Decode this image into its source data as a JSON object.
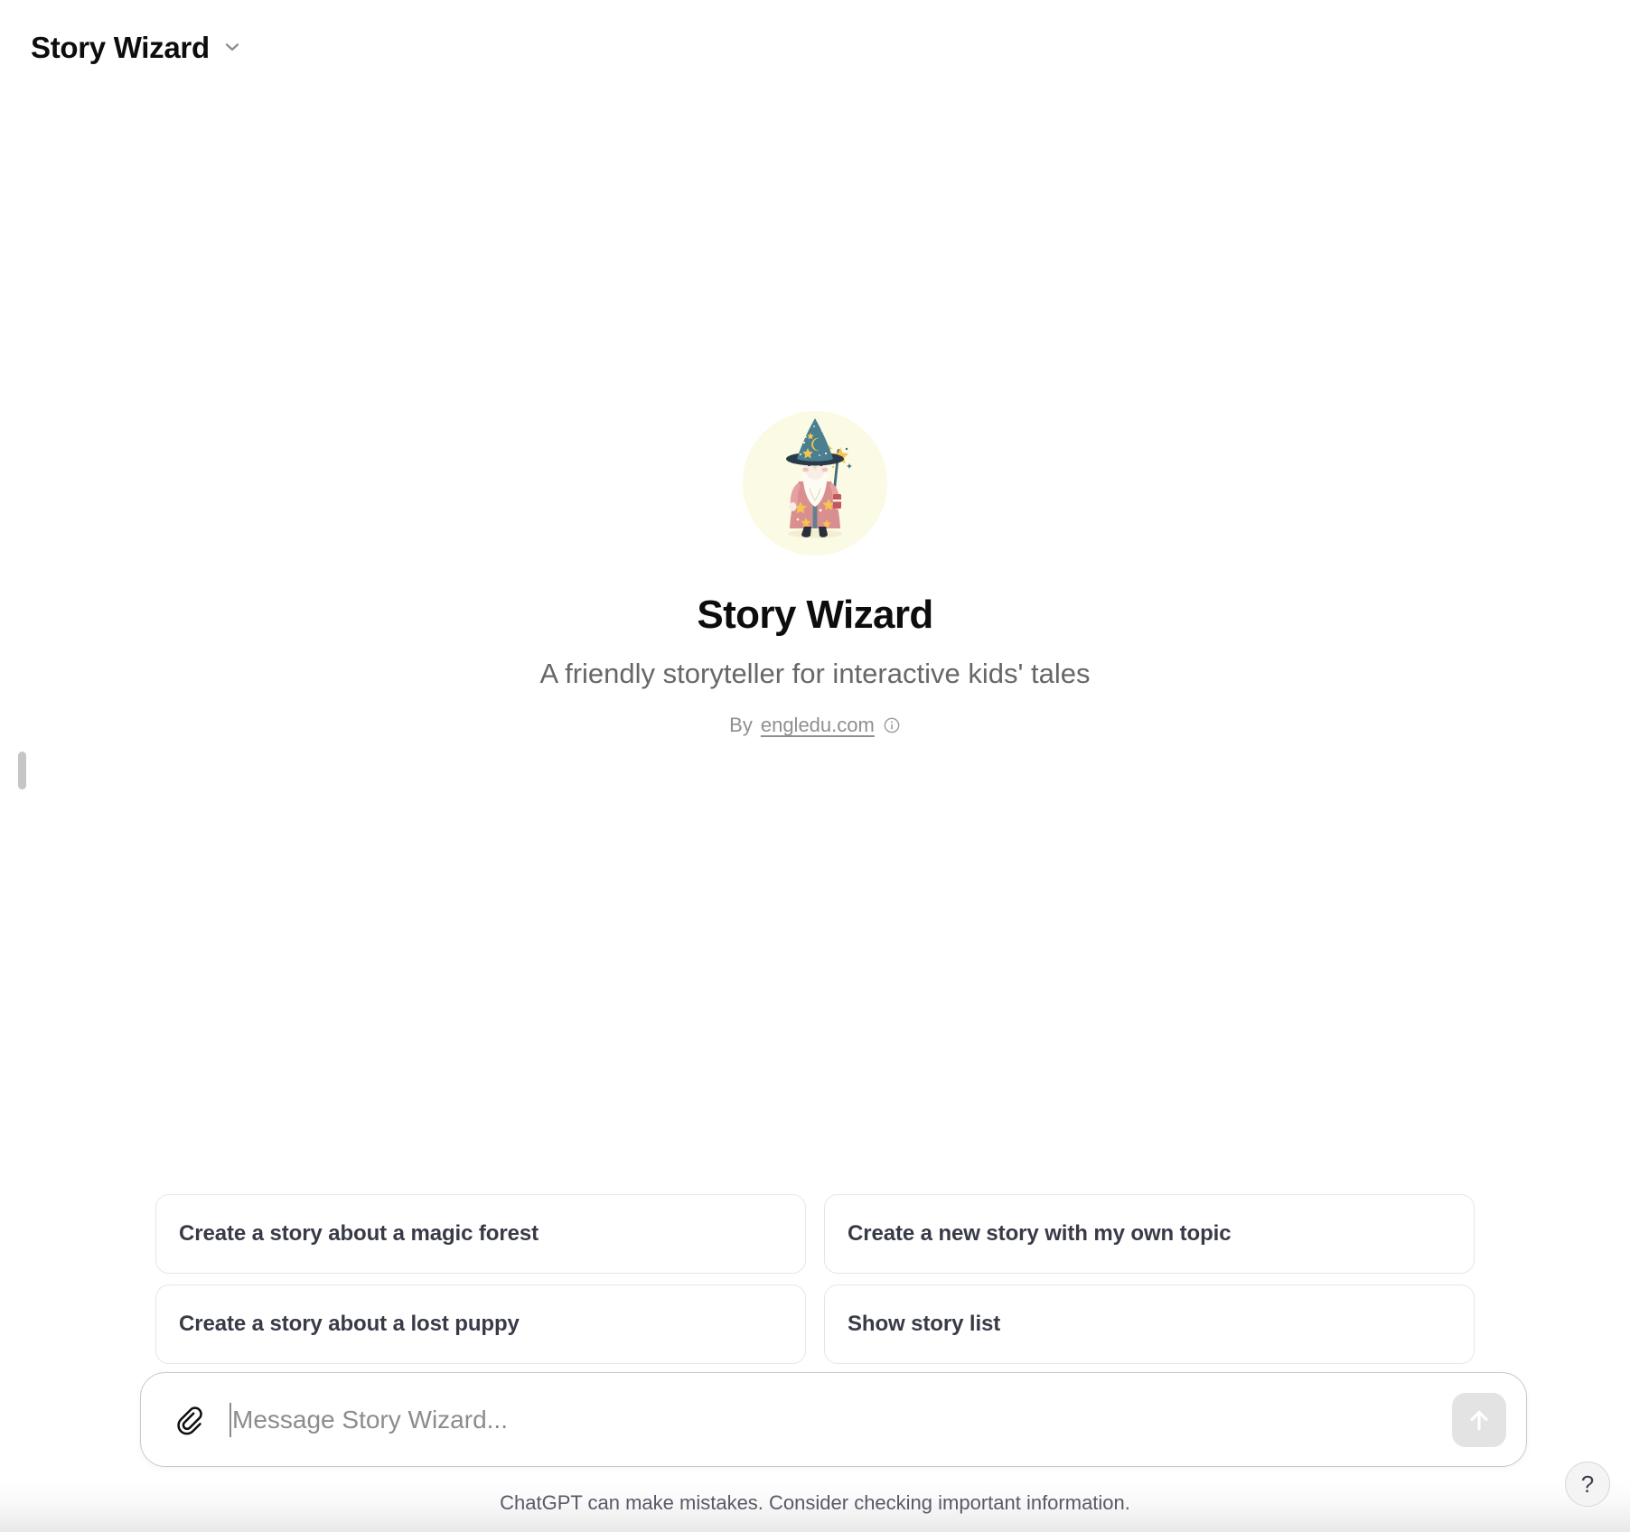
{
  "topbar": {
    "title": "Story Wizard",
    "chevron_icon": "chevron-down-icon"
  },
  "intro": {
    "avatar_icon": "wizard-avatar",
    "title": "Story Wizard",
    "subtitle": "A friendly storyteller for interactive kids' tales",
    "byline_prefix": "By",
    "byline_link": "engledu.com",
    "info_icon": "info-circle-icon"
  },
  "suggestions": [
    {
      "label": "Create a story about a magic forest"
    },
    {
      "label": "Create a new story with my own topic"
    },
    {
      "label": "Create a story about a lost puppy"
    },
    {
      "label": "Show story list"
    }
  ],
  "composer": {
    "attach_icon": "paperclip-icon",
    "placeholder": "Message Story Wizard...",
    "value": "",
    "send_icon": "arrow-up-icon"
  },
  "footer": {
    "disclaimer": "ChatGPT can make mistakes. Consider checking important information.",
    "help_label": "?"
  },
  "colors": {
    "page_background": "#ffffff",
    "text_primary": "#0d0d0d",
    "text_secondary": "#676767",
    "text_muted": "#8f8f8f",
    "suggestion_text": "#383b47",
    "suggestion_border": "#e6e6e6",
    "composer_border": "#c9c9c9",
    "send_button_background": "#e3e3e3",
    "avatar_background": "#fbfae4",
    "wizard_hat": "#4a7f90",
    "wizard_robe": "#d98f90",
    "wizard_star": "#f5c451",
    "footer_text": "#575a68",
    "scrollbar_thumb": "#c6c6c6"
  }
}
